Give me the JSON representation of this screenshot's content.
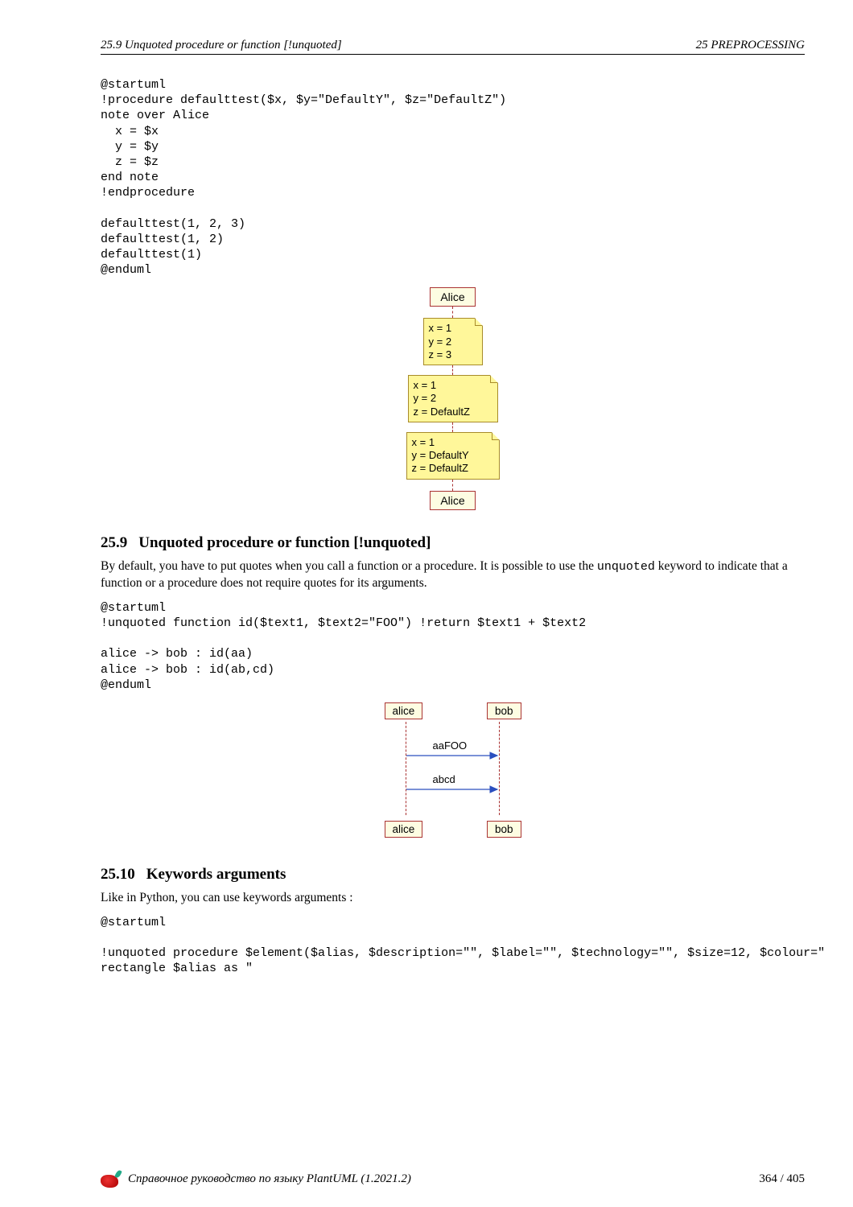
{
  "header": {
    "left": "25.9   Unquoted procedure or function [!unquoted]",
    "right": "25   PREPROCESSING"
  },
  "code1": "@startuml\n!procedure defaulttest($x, $y=\"DefaultY\", $z=\"DefaultZ\")\nnote over Alice\n  x = $x\n  y = $y\n  z = $z\nend note\n!endprocedure\n\ndefaulttest(1, 2, 3)\ndefaulttest(1, 2)\ndefaulttest(1)\n@enduml",
  "diagram1": {
    "actor": "Alice",
    "notes": [
      [
        "x = 1",
        "y = 2",
        "z = 3"
      ],
      [
        "x = 1",
        "y = 2",
        "z = DefaultZ"
      ],
      [
        "x = 1",
        "y = DefaultY",
        "z = DefaultZ"
      ]
    ]
  },
  "section_25_9": {
    "num": "25.9",
    "title": "Unquoted procedure or function [!unquoted]",
    "para_a": "By default, you have to put quotes when you call a function or a procedure.  It is possible to use the ",
    "kw": "unquoted",
    "para_b": " keyword to indicate that a function or a procedure does not require quotes for its arguments."
  },
  "code2": "@startuml\n!unquoted function id($text1, $text2=\"FOO\") !return $text1 + $text2\n\nalice -> bob : id(aa)\nalice -> bob : id(ab,cd)\n@enduml",
  "diagram2": {
    "actors": [
      "alice",
      "bob"
    ],
    "messages": [
      "aaFOO",
      "abcd"
    ]
  },
  "section_25_10": {
    "num": "25.10",
    "title": "Keywords arguments",
    "para": "Like in Python, you can use keywords arguments :"
  },
  "code3": "@startuml\n\n!unquoted procedure $element($alias, $description=\"\", $label=\"\", $technology=\"\", $size=12, $colour=\"\nrectangle $alias as \"",
  "footer": {
    "title": "Справочное руководство по языку PlantUML (1.2021.2)",
    "page": "364 / 405"
  }
}
